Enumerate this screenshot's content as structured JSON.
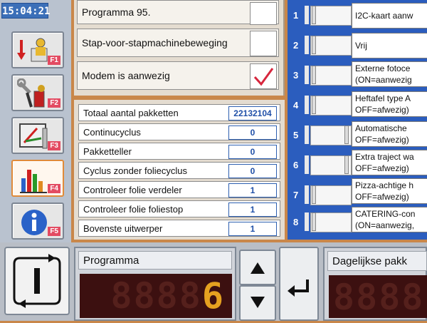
{
  "sidebar": {
    "clock": "15:04:21",
    "keys": [
      {
        "label": "F1",
        "icon": "operator-machine-icon"
      },
      {
        "label": "F2",
        "icon": "maintenance-tools-icon"
      },
      {
        "label": "F3",
        "icon": "settings-dial-icon"
      },
      {
        "label": "F4",
        "icon": "statistics-chart-icon"
      },
      {
        "label": "F5",
        "icon": "info-icon"
      }
    ]
  },
  "options": [
    {
      "label": "Programma 95.",
      "checked": false
    },
    {
      "label": "Stap-voor-stapmachinebeweging",
      "checked": false
    },
    {
      "label": "Modem is aanwezig",
      "checked": true
    }
  ],
  "counters": [
    {
      "label": "Totaal aantal pakketten",
      "value": "22132104"
    },
    {
      "label": "Continucyclus",
      "value": "0"
    },
    {
      "label": "Pakketteller",
      "value": "0"
    },
    {
      "label": "Cyclus zonder foliecyclus",
      "value": "0"
    },
    {
      "label": "Controleer folie verdeler",
      "value": "1"
    },
    {
      "label": "Controleer folie foliestop",
      "value": "1"
    },
    {
      "label": "Bovenste uitwerper",
      "value": "1"
    }
  ],
  "switches": [
    {
      "num": "1",
      "line1": "I2C-kaart aanw",
      "line2": "",
      "state": "left"
    },
    {
      "num": "2",
      "line1": "Vrij",
      "line2": "",
      "state": "left"
    },
    {
      "num": "3",
      "line1": "Externe fotoce",
      "line2": "(ON=aanwezig",
      "state": "left"
    },
    {
      "num": "4",
      "line1": "Heftafel type A",
      "line2": "OFF=afwezig)",
      "state": "left"
    },
    {
      "num": "5",
      "line1": "Automatische",
      "line2": "OFF=afwezig)",
      "state": "right"
    },
    {
      "num": "6",
      "line1": "Extra traject wa",
      "line2": "OFF=afwezig)",
      "state": "right"
    },
    {
      "num": "7",
      "line1": "Pizza-achtige h",
      "line2": "OFF=afwezig)",
      "state": "left"
    },
    {
      "num": "8",
      "line1": "CATERING-con",
      "line2": "(ON=aanwezig,",
      "state": "left"
    }
  ],
  "program": {
    "label": "Programma",
    "dim_digits": "8888",
    "value": "6"
  },
  "daily": {
    "label": "Dagelijkse pakk",
    "dim_digits": "8888"
  },
  "colors": {
    "accent_blue": "#2b5dbe",
    "frame_orange": "#c9874a",
    "segment_lit": "#e5a120",
    "check_red": "#d7263d"
  }
}
